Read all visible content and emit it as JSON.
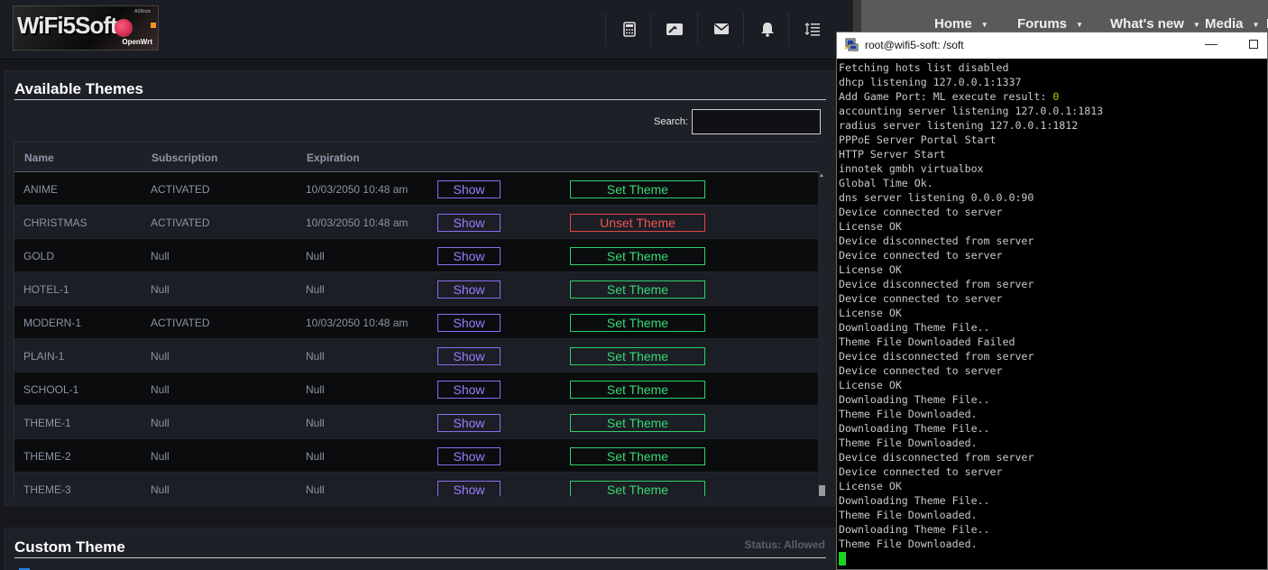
{
  "topbar": {
    "logo_text": "WiFi5Soft",
    "logo_sub": "OpenWrt",
    "logo_tag": "ASRock",
    "icons": [
      "calculator-icon",
      "dashboard-icon",
      "mail-icon",
      "bell-icon",
      "sort-icon"
    ],
    "glyphs": [
      "▦",
      "◩",
      "✉",
      "🔔",
      "☰"
    ]
  },
  "themes_panel": {
    "title": "Available Themes",
    "search_label": "Search:",
    "search_value": "",
    "columns": [
      "Name",
      "Subscription",
      "Expiration"
    ],
    "rows": [
      {
        "name": "ANIME",
        "subscription": "ACTIVATED",
        "expiration": "10/03/2050 10:48 am",
        "show_label": "Show",
        "action_label": "Set Theme",
        "action": "set"
      },
      {
        "name": "CHRISTMAS",
        "subscription": "ACTIVATED",
        "expiration": "10/03/2050 10:48 am",
        "show_label": "Show",
        "action_label": "Unset Theme",
        "action": "unset"
      },
      {
        "name": "GOLD",
        "subscription": "Null",
        "expiration": "Null",
        "show_label": "Show",
        "action_label": "Set Theme",
        "action": "set"
      },
      {
        "name": "HOTEL-1",
        "subscription": "Null",
        "expiration": "Null",
        "show_label": "Show",
        "action_label": "Set Theme",
        "action": "set"
      },
      {
        "name": "MODERN-1",
        "subscription": "ACTIVATED",
        "expiration": "10/03/2050 10:48 am",
        "show_label": "Show",
        "action_label": "Set Theme",
        "action": "set"
      },
      {
        "name": "PLAIN-1",
        "subscription": "Null",
        "expiration": "Null",
        "show_label": "Show",
        "action_label": "Set Theme",
        "action": "set"
      },
      {
        "name": "SCHOOL-1",
        "subscription": "Null",
        "expiration": "Null",
        "show_label": "Show",
        "action_label": "Set Theme",
        "action": "set"
      },
      {
        "name": "THEME-1",
        "subscription": "Null",
        "expiration": "Null",
        "show_label": "Show",
        "action_label": "Set Theme",
        "action": "set"
      },
      {
        "name": "THEME-2",
        "subscription": "Null",
        "expiration": "Null",
        "show_label": "Show",
        "action_label": "Set Theme",
        "action": "set"
      },
      {
        "name": "THEME-3",
        "subscription": "Null",
        "expiration": "Null",
        "show_label": "Show",
        "action_label": "Set Theme",
        "action": "set"
      }
    ]
  },
  "custom_panel": {
    "title": "Custom Theme",
    "status": "Status: Allowed"
  },
  "forum_nav": {
    "items": [
      "Home",
      "Forums",
      "What's new",
      "Media",
      "M"
    ],
    "active": "Forums"
  },
  "terminal": {
    "title": "root@wifi5-soft: /soft",
    "minimize_glyph": "—",
    "lines": [
      "Fetching hots list disabled",
      "dhcp listening 127.0.0.1:1337",
      "Add Game Port: ML execute result: ",
      "accounting server listening 127.0.0.1:1813",
      "radius server listening 127.0.0.1:1812",
      "PPPoE Server Portal Start",
      "HTTP Server Start",
      "innotek gmbh virtualbox",
      "Global Time Ok.",
      "dns server listening 0.0.0.0:90",
      "Device connected to server",
      "License OK",
      "Device disconnected from server",
      "Device connected to server",
      "License OK",
      "Device disconnected from server",
      "Device connected to server",
      "License OK",
      "Downloading Theme File..",
      "Theme File Downloaded Failed",
      "Device disconnected from server",
      "Device connected to server",
      "License OK",
      "Downloading Theme File..",
      "Theme File Downloaded.",
      "Downloading Theme File..",
      "Theme File Downloaded.",
      "Device disconnected from server",
      "Device connected to server",
      "License OK",
      "Downloading Theme File..",
      "Theme File Downloaded.",
      "Downloading Theme File..",
      "Theme File Downloaded."
    ],
    "ml_result_value": "0"
  },
  "colors": {
    "show_button": "#9a7dff",
    "set_theme": "#36d873",
    "unset_theme": "#f05555",
    "cursor": "#1ed21e"
  }
}
